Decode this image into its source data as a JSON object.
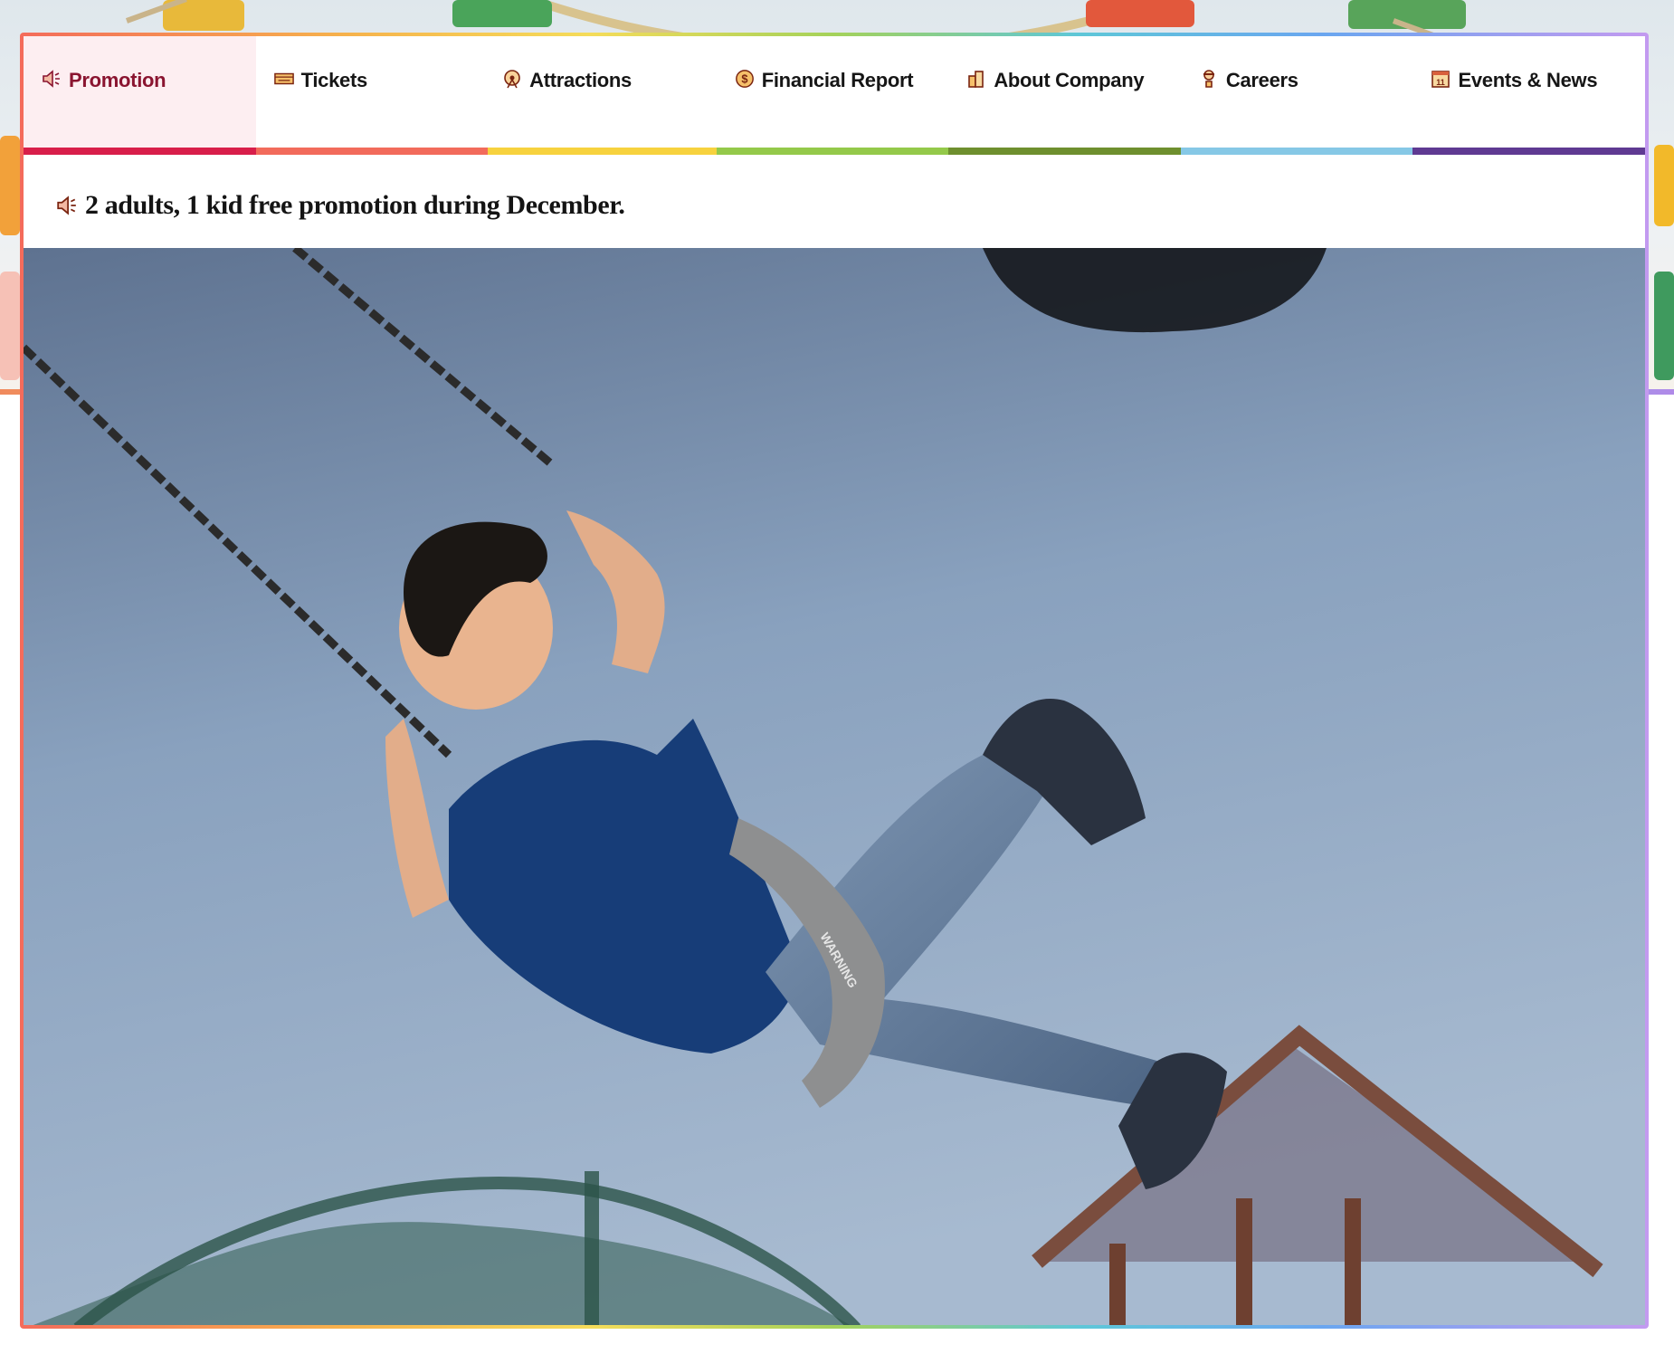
{
  "tabs": [
    {
      "label": "Promotion",
      "icon": "megaphone-icon",
      "bar_color": "#d81e4a",
      "active": true
    },
    {
      "label": "Tickets",
      "icon": "ticket-icon",
      "bar_color": "#f26b5b",
      "active": false
    },
    {
      "label": "Attractions",
      "icon": "ferris-wheel-icon",
      "bar_color": "#f7d23e",
      "active": false
    },
    {
      "label": "Financial Report",
      "icon": "dollar-coin-icon",
      "bar_color": "#94c94a",
      "active": false
    },
    {
      "label": "About Company",
      "icon": "building-icon",
      "bar_color": "#6e8f2e",
      "active": false
    },
    {
      "label": "Careers",
      "icon": "person-icon",
      "bar_color": "#86c8e6",
      "active": false
    },
    {
      "label": "Events & News",
      "icon": "calendar-icon",
      "bar_color": "#5f3a92",
      "active": false
    }
  ],
  "promo": {
    "text": "2 adults, 1 kid free promotion during December.",
    "icon": "megaphone-icon"
  },
  "hero": {
    "subject": "photo",
    "seat_text": "WARNING"
  },
  "colors": {
    "accent": "#d81e4a",
    "active_tab_bg": "#fdeef1",
    "active_tab_text": "#8a1430"
  }
}
